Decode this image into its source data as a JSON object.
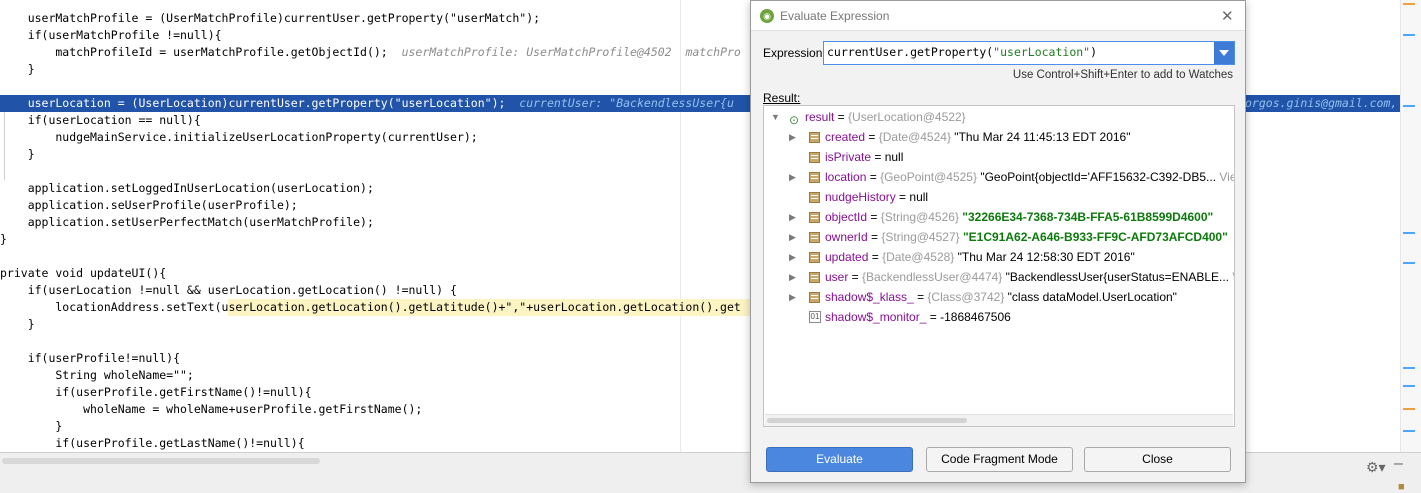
{
  "editor": {
    "lines": [
      {
        "text": "    userMatchProfile = (UserMatchProfile)currentUser.getProperty(\"userMatch\");",
        "hint": ""
      },
      {
        "text": "    if(userMatchProfile !=null){",
        "hint": ""
      },
      {
        "text": "        matchProfileId = userMatchProfile.getObjectId();",
        "hint": "  userMatchProfile: UserMatchProfile@4502  matchPro"
      },
      {
        "text": "    }",
        "hint": ""
      },
      {
        "text": "",
        "hint": ""
      },
      {
        "text": "    userLocation = (UserLocation)currentUser.getProperty(\"userLocation\");",
        "hint": "  currentUser: \"BackendlessUser{u",
        "exec": true,
        "tail": "orgos.ginis@gmail.com, u"
      },
      {
        "text": "    if(userLocation == null){",
        "hint": ""
      },
      {
        "text": "        nudgeMainService.initializeUserLocationProperty(currentUser);",
        "hint": ""
      },
      {
        "text": "    }",
        "hint": ""
      },
      {
        "text": "",
        "hint": ""
      },
      {
        "text": "    application.setLoggedInUserLocation(userLocation);",
        "hint": ""
      },
      {
        "text": "    application.seUserProfile(userProfile);",
        "hint": ""
      },
      {
        "text": "    application.setUserPerfectMatch(userMatchProfile);",
        "hint": ""
      },
      {
        "text": "}",
        "hint": ""
      },
      {
        "text": "",
        "hint": ""
      },
      {
        "text": "private void updateUI(){",
        "hint": ""
      },
      {
        "text": "    if(userLocation !=null && userLocation.getLocation() !=null) {",
        "hint": ""
      },
      {
        "text": "        locationAddress.setText(userLocation.getLocation().getLatitude()+\",\"+userLocation.getLocation().get",
        "hint": ""
      },
      {
        "text": "    }",
        "hint": ""
      },
      {
        "text": "",
        "hint": ""
      },
      {
        "text": "    if(userProfile!=null){",
        "hint": ""
      },
      {
        "text": "        String wholeName=\"\";",
        "hint": ""
      },
      {
        "text": "        if(userProfile.getFirstName()!=null){",
        "hint": ""
      },
      {
        "text": "            wholeName = wholeName+userProfile.getFirstName();",
        "hint": ""
      },
      {
        "text": "        }",
        "hint": ""
      },
      {
        "text": "        if(userProfile.getLastName()!=null){",
        "hint": ""
      }
    ]
  },
  "dialog": {
    "title": "Evaluate Expression",
    "expression_label": "Expression:",
    "expression_code": "currentUser.getProperty(",
    "expression_string": "\"userLocation\"",
    "expression_close": ")",
    "watch_hint": "Use Control+Shift+Enter to add to Watches",
    "result_label": "Result:",
    "tree": [
      {
        "level": 0,
        "arrow": "▼",
        "icon": "result",
        "name": "result",
        "eq": " = ",
        "type": "{UserLocation@4522}",
        "value": "",
        "value_style": "",
        "view": ""
      },
      {
        "level": 1,
        "arrow": "▶",
        "icon": "field",
        "name": "created",
        "eq": " = ",
        "type": "{Date@4524}",
        "value": " \"Thu Mar 24 11:45:13 EDT 2016\"",
        "value_style": "",
        "view": ""
      },
      {
        "level": 1,
        "arrow": "",
        "icon": "field",
        "name": "isPrivate",
        "eq": " = ",
        "type": "",
        "value": "null",
        "value_style": "",
        "view": ""
      },
      {
        "level": 1,
        "arrow": "▶",
        "icon": "field",
        "name": "location",
        "eq": " = ",
        "type": "{GeoPoint@4525}",
        "value": " \"GeoPoint{objectId='AFF15632-C392-DB5...",
        "value_style": "",
        "view": " View"
      },
      {
        "level": 1,
        "arrow": "",
        "icon": "field",
        "name": "nudgeHistory",
        "eq": " = ",
        "type": "",
        "value": "null",
        "value_style": "",
        "view": ""
      },
      {
        "level": 1,
        "arrow": "▶",
        "icon": "field",
        "name": "objectId",
        "eq": " = ",
        "type": "{String@4526}",
        "value": " \"32266E34-7368-734B-FFA5-61B8599D4600\"",
        "value_style": "green",
        "view": ""
      },
      {
        "level": 1,
        "arrow": "▶",
        "icon": "field",
        "name": "ownerId",
        "eq": " = ",
        "type": "{String@4527}",
        "value": " \"E1C91A62-A646-B933-FF9C-AFD73AFCD400\"",
        "value_style": "green",
        "view": ""
      },
      {
        "level": 1,
        "arrow": "▶",
        "icon": "field",
        "name": "updated",
        "eq": " = ",
        "type": "{Date@4528}",
        "value": " \"Thu Mar 24 12:58:30 EDT 2016\"",
        "value_style": "",
        "view": ""
      },
      {
        "level": 1,
        "arrow": "▶",
        "icon": "field",
        "name": "user",
        "eq": " = ",
        "type": "{BackendlessUser@4474}",
        "value": " \"BackendlessUser{userStatus=ENABLE...",
        "value_style": "",
        "view": " View"
      },
      {
        "level": 1,
        "arrow": "▶",
        "icon": "field",
        "name": "shadow$_klass_",
        "eq": " = ",
        "type": "{Class@3742}",
        "value": " \"class dataModel.UserLocation\"",
        "value_style": "",
        "view": ""
      },
      {
        "level": 1,
        "arrow": "",
        "icon": "number",
        "name": "shadow$_monitor_",
        "eq": " = ",
        "type": "",
        "value": "-1868467506",
        "value_style": "",
        "view": ""
      }
    ],
    "buttons": {
      "evaluate": "Evaluate",
      "code_fragment": "Code Fragment Mode",
      "close": "Close"
    }
  }
}
